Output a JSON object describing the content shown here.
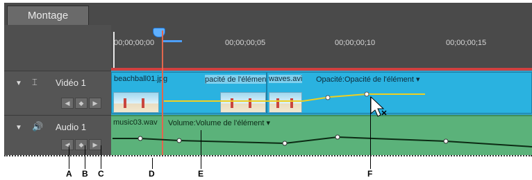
{
  "tabs": {
    "montage": "Montage"
  },
  "ruler": {
    "times": [
      "00;00;00;00",
      "00;00;00;05",
      "00;00;00;10",
      "00;00;00;15"
    ]
  },
  "tracks": {
    "video": {
      "name": "Vidéo 1",
      "clips": [
        {
          "file": "beachball01.jpg",
          "property": "pacité de l'élément ▾"
        },
        {
          "file": "waves.avi",
          "property": "Opacité:Opacité de l'élément ▾"
        }
      ]
    },
    "audio": {
      "name": "Audio 1",
      "clip": {
        "file": "music03.wav",
        "property": "Volume:Volume de l'élément ▾"
      }
    }
  },
  "keyframe_controls": {
    "prev": "◀",
    "add": "◆",
    "next": "▶"
  },
  "callouts": [
    "A",
    "B",
    "C",
    "D",
    "E",
    "F"
  ],
  "colors": {
    "video_clip": "#2ab2e0",
    "audio_clip": "#5bb27a",
    "playhead": "#e2674d",
    "keyframe_line": "#f0d020"
  }
}
